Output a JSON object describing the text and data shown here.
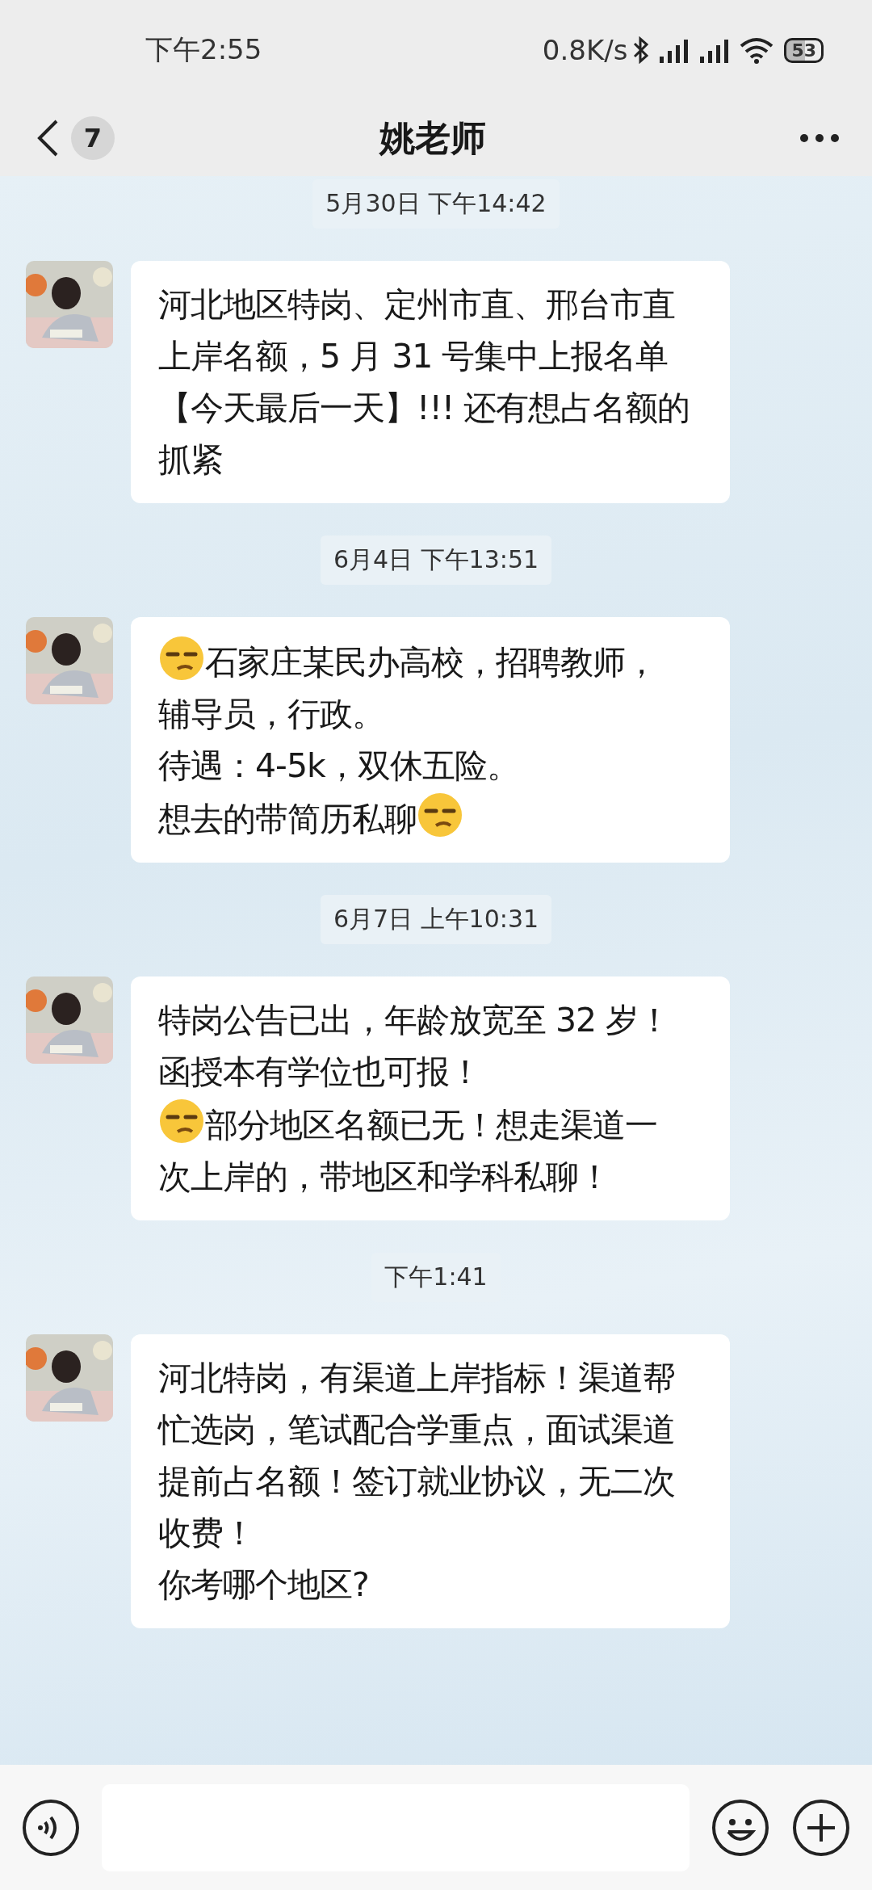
{
  "status_bar": {
    "time": "下午2:55",
    "speed": "0.8K/s",
    "battery": "53"
  },
  "header": {
    "unread": "7",
    "title": "姚老师"
  },
  "messages": [
    {
      "kind": "time",
      "text": "5月30日 下午14:42"
    },
    {
      "kind": "bubble",
      "lines": [
        [
          {
            "kind": "text",
            "text": "河北地区特岗、定州市直、邢台市直上岸名额，5 月 31 号集中上报名单"
          }
        ],
        [
          {
            "kind": "text",
            "text": "【今天最后一天】!!! 还有想占名额的抓紧"
          }
        ]
      ]
    },
    {
      "kind": "time",
      "text": "6月4日 下午13:51"
    },
    {
      "kind": "bubble",
      "lines": [
        [
          {
            "kind": "emoji"
          },
          {
            "kind": "text",
            "text": "石家庄某民办高校，招聘教师，"
          }
        ],
        [
          {
            "kind": "text",
            "text": "辅导员，行政。"
          }
        ],
        [
          {
            "kind": "text",
            "text": "待遇：4-5k，双休五险。"
          }
        ],
        [
          {
            "kind": "text",
            "text": "想去的带简历私聊"
          },
          {
            "kind": "emoji"
          }
        ]
      ]
    },
    {
      "kind": "time",
      "text": "6月7日 上午10:31"
    },
    {
      "kind": "bubble",
      "lines": [
        [
          {
            "kind": "text",
            "text": "特岗公告已出，年龄放宽至 32 岁！"
          }
        ],
        [
          {
            "kind": "text",
            "text": "函授本有学位也可报！"
          }
        ],
        [
          {
            "kind": "emoji"
          },
          {
            "kind": "text",
            "text": "部分地区名额已无！想走渠道一"
          }
        ],
        [
          {
            "kind": "text",
            "text": "次上岸的，带地区和学科私聊！"
          }
        ]
      ]
    },
    {
      "kind": "time",
      "text": "下午1:41"
    },
    {
      "kind": "bubble",
      "lines": [
        [
          {
            "kind": "text",
            "text": "河北特岗，有渠道上岸指标！渠道帮忙选岗，笔试配合学重点，面试渠道提前占名额！签订就业协议，无二次收费！"
          }
        ],
        [
          {
            "kind": "text",
            "text": "你考哪个地区?"
          }
        ]
      ]
    }
  ]
}
